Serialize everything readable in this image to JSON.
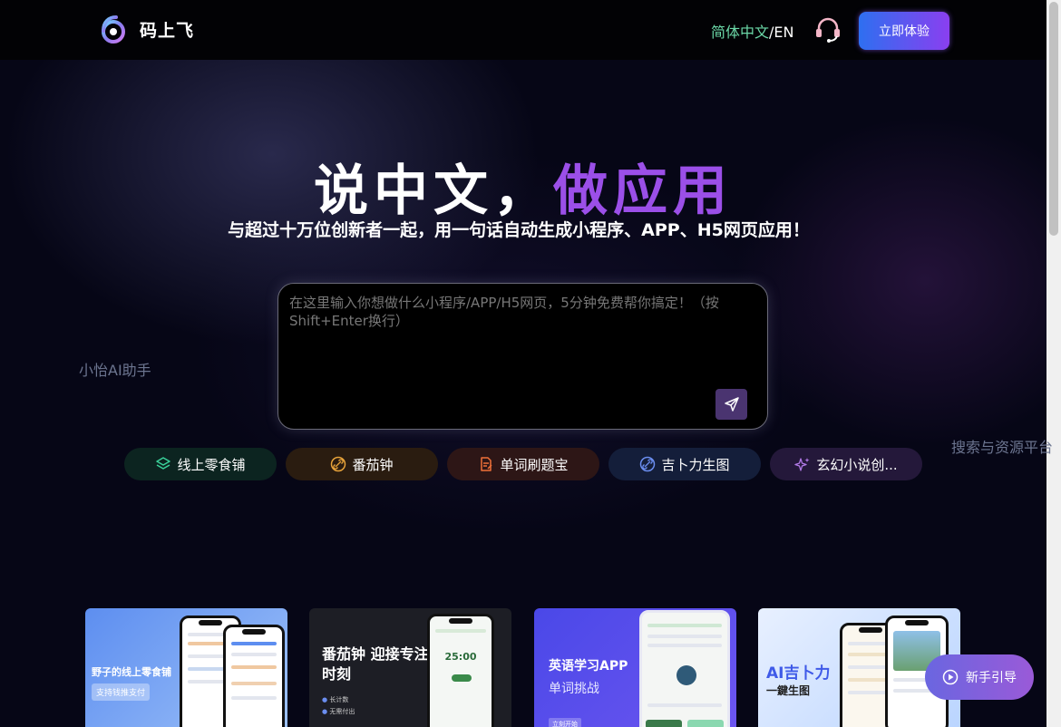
{
  "header": {
    "brand": "码上飞",
    "lang_zh": "简体中文",
    "lang_sep": "/",
    "lang_en": "EN",
    "cta": "立即体验"
  },
  "hero": {
    "title_white": "说中文，",
    "title_purple": "做应用",
    "subtitle": "与超过十万位创新者一起，用一句话自动生成小程序、APP、H5网页应用！"
  },
  "side_links": {
    "left": "小怡AI助手",
    "right": "搜索与资源平台"
  },
  "prompt": {
    "placeholder": "在这里输入你想做什么小程序/APP/H5网页，5分钟免费帮你搞定！（按Shift+Enter换行）",
    "value": ""
  },
  "chips": [
    {
      "label": "线上零食铺",
      "color": "#3ad19a",
      "icon": "layers-icon"
    },
    {
      "label": "番茄钟",
      "color": "#e8a33a",
      "icon": "link-icon"
    },
    {
      "label": "单词刷题宝",
      "color": "#f07038",
      "icon": "document-icon"
    },
    {
      "label": "吉卜力生图",
      "color": "#6b8ef0",
      "icon": "link-icon"
    },
    {
      "label": "玄幻小说创...",
      "color": "#b27ae8",
      "icon": "sparkle-icon"
    }
  ],
  "cards": [
    {
      "title": "野子的线上零食铺",
      "tag": "支持钱推支付"
    },
    {
      "title": "番茄钟 迎接专注时刻",
      "items": [
        "长计数",
        "无需付出"
      ],
      "timer": "25:00"
    },
    {
      "title": "英语学习APP",
      "subtitle": "单词挑战",
      "tag": "立刻开始"
    },
    {
      "title": "AI吉卜力",
      "subtitle": "一鍵生图"
    }
  ],
  "guide": {
    "label": "新手引导"
  }
}
